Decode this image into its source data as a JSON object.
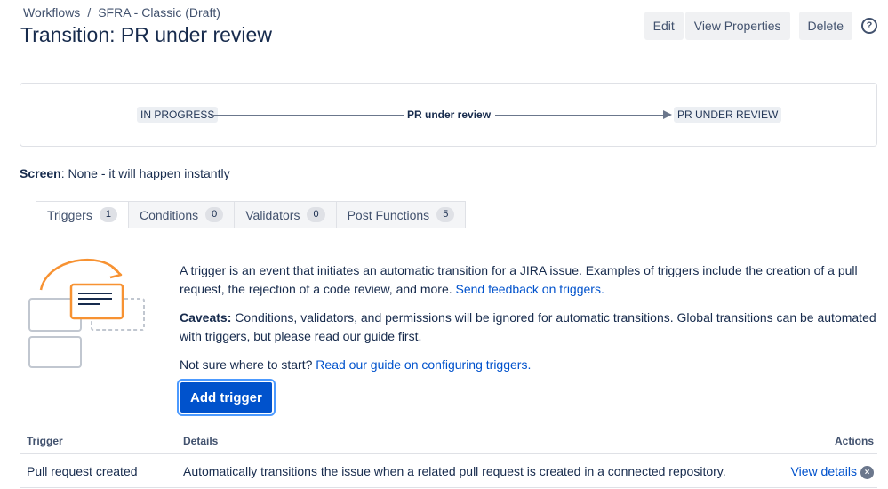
{
  "breadcrumb": {
    "items": [
      "Workflows",
      "SFRA - Classic (Draft)"
    ],
    "separator": "/"
  },
  "page_title": "Transition: PR under review",
  "actions": {
    "edit": "Edit",
    "view_properties": "View Properties",
    "delete": "Delete",
    "help_icon": "?"
  },
  "diagram": {
    "from_status": "IN PROGRESS",
    "transition": "PR under review",
    "to_status": "PR UNDER REVIEW"
  },
  "screen": {
    "label": "Screen",
    "value": ": None - it will happen instantly"
  },
  "tabs": [
    {
      "label": "Triggers",
      "count": "1"
    },
    {
      "label": "Conditions",
      "count": "0"
    },
    {
      "label": "Validators",
      "count": "0"
    },
    {
      "label": "Post Functions",
      "count": "5"
    }
  ],
  "description": {
    "intro": "A trigger is an event that initiates an automatic transition for a JIRA issue. Examples of triggers include the creation of a pull request, the rejection of a code review, and more. ",
    "feedback_link": "Send feedback on triggers.",
    "caveats_label": "Caveats:",
    "caveats_text": " Conditions, validators, and permissions will be ignored for automatic transitions. Global transitions can be automated with triggers, but please read our guide first.",
    "guide_prompt": "Not sure where to start? ",
    "guide_link": "Read our guide on configuring triggers."
  },
  "add_trigger_label": "Add trigger",
  "table": {
    "headers": {
      "trigger": "Trigger",
      "details": "Details",
      "actions": "Actions"
    },
    "rows": [
      {
        "trigger": "Pull request created",
        "details": "Automatically transitions the issue when a related pull request is created in a connected repository.",
        "action": "View details",
        "remove_icon": "×"
      }
    ]
  },
  "colors": {
    "accent": "#0052cc",
    "illustration_orange": "#f79232",
    "text": "#172b4d",
    "muted": "#42526e"
  }
}
